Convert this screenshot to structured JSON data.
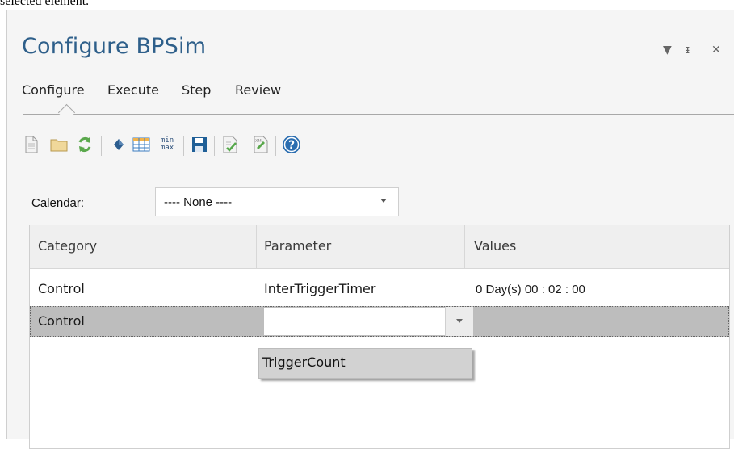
{
  "top_caption": "selected element.",
  "window": {
    "title": "Configure BPSim",
    "controls": {
      "menu_glyph": "▼",
      "pin_glyph": "ᵻ",
      "close_glyph": "✕"
    }
  },
  "tabs": [
    {
      "label": "Configure",
      "active": true
    },
    {
      "label": "Execute",
      "active": false
    },
    {
      "label": "Step",
      "active": false
    },
    {
      "label": "Review",
      "active": false
    }
  ],
  "toolbar": {
    "icons": [
      "new-document-icon",
      "open-folder-icon",
      "refresh-icon",
      "element-diamond-icon",
      "table-grid-icon",
      "min-max-icon",
      "save-icon",
      "validate-icon",
      "xml-export-icon",
      "help-icon"
    ],
    "min_text": "min",
    "max_text": "max",
    "xml_text": "XML"
  },
  "calendar": {
    "label": "Calendar:",
    "value": "---- None ----"
  },
  "grid": {
    "headers": [
      "Category",
      "Parameter",
      "Values"
    ],
    "rows": [
      {
        "category": "Control",
        "parameter": "InterTriggerTimer",
        "values": "0 Day(s) 00 : 02 : 00"
      },
      {
        "category": "Control",
        "parameter": "",
        "values": ""
      }
    ],
    "dropdown_options": [
      "TriggerCount"
    ]
  },
  "colors": {
    "title_blue": "#2e5f8a",
    "selected_row": "#bdbdbd",
    "help_blue": "#2a6db0"
  }
}
